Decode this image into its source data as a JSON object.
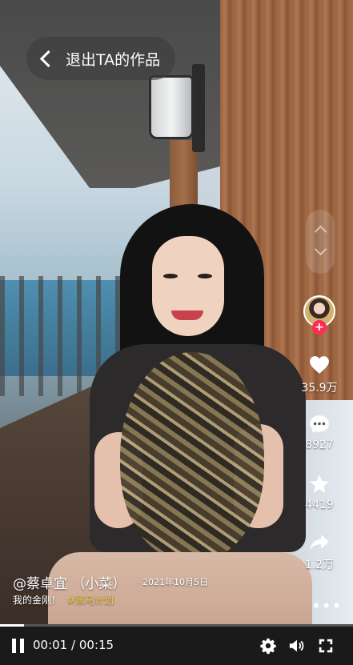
{
  "header": {
    "back_label": "退出TA的作品"
  },
  "author": {
    "name": "@蔡卓宜 （小菜）",
    "date": "· 2021年10月5日"
  },
  "caption": {
    "text": "我的金刚！",
    "hashtag": "#黑马计划"
  },
  "actions": {
    "like_count": "35.9万",
    "comment_count": "8927",
    "favorite_count": "4419",
    "share_count": "1.2万"
  },
  "avatar": {
    "follow_symbol": "+"
  },
  "player": {
    "current_time": "00:01",
    "separator": "/",
    "duration": "00:15",
    "progress": 0.067
  },
  "colors": {
    "accent": "#fe2c55",
    "hashtag": "#f7c948"
  }
}
